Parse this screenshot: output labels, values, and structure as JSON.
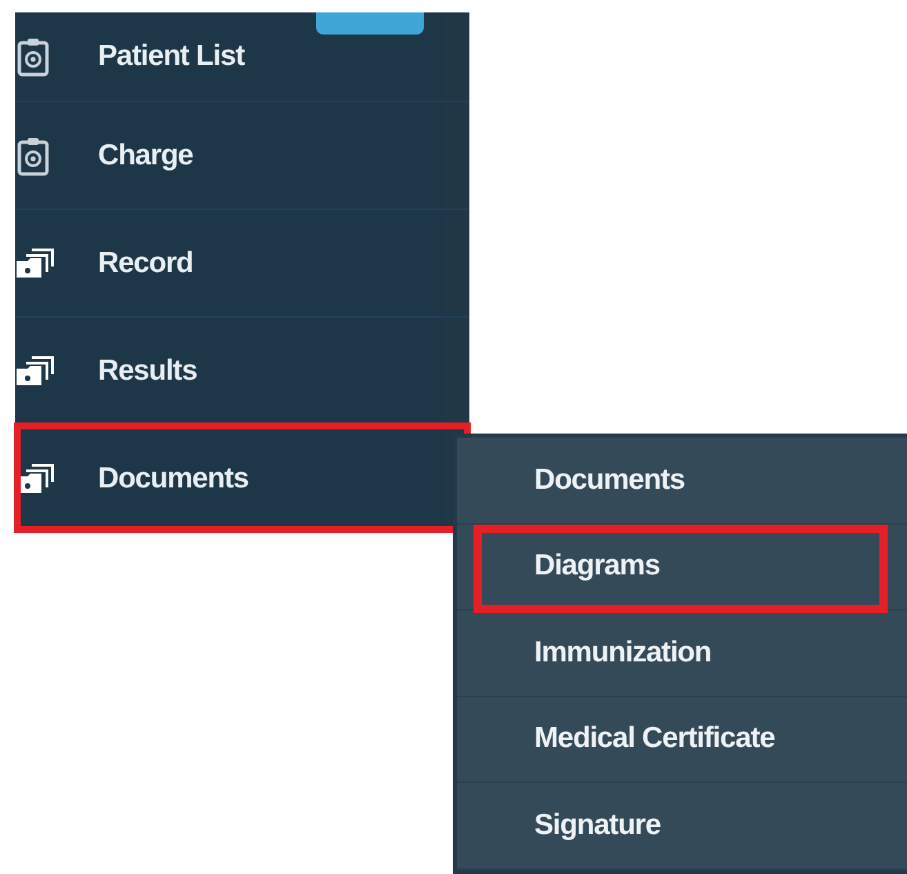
{
  "sidebar": {
    "items": [
      {
        "label": "Patient List",
        "kind": "clipboard",
        "highlighted": false
      },
      {
        "label": "Charge",
        "kind": "clipboard",
        "highlighted": false
      },
      {
        "label": "Record",
        "kind": "folders",
        "highlighted": false
      },
      {
        "label": "Results",
        "kind": "folders",
        "highlighted": false
      },
      {
        "label": "Documents",
        "kind": "folders",
        "highlighted": true
      }
    ]
  },
  "submenu": {
    "items": [
      {
        "label": "Documents",
        "highlighted": false
      },
      {
        "label": "Diagrams",
        "highlighted": true
      },
      {
        "label": "Immunization",
        "highlighted": false
      },
      {
        "label": "Medical Certificate",
        "highlighted": false
      },
      {
        "label": "Signature",
        "highlighted": false
      }
    ]
  }
}
